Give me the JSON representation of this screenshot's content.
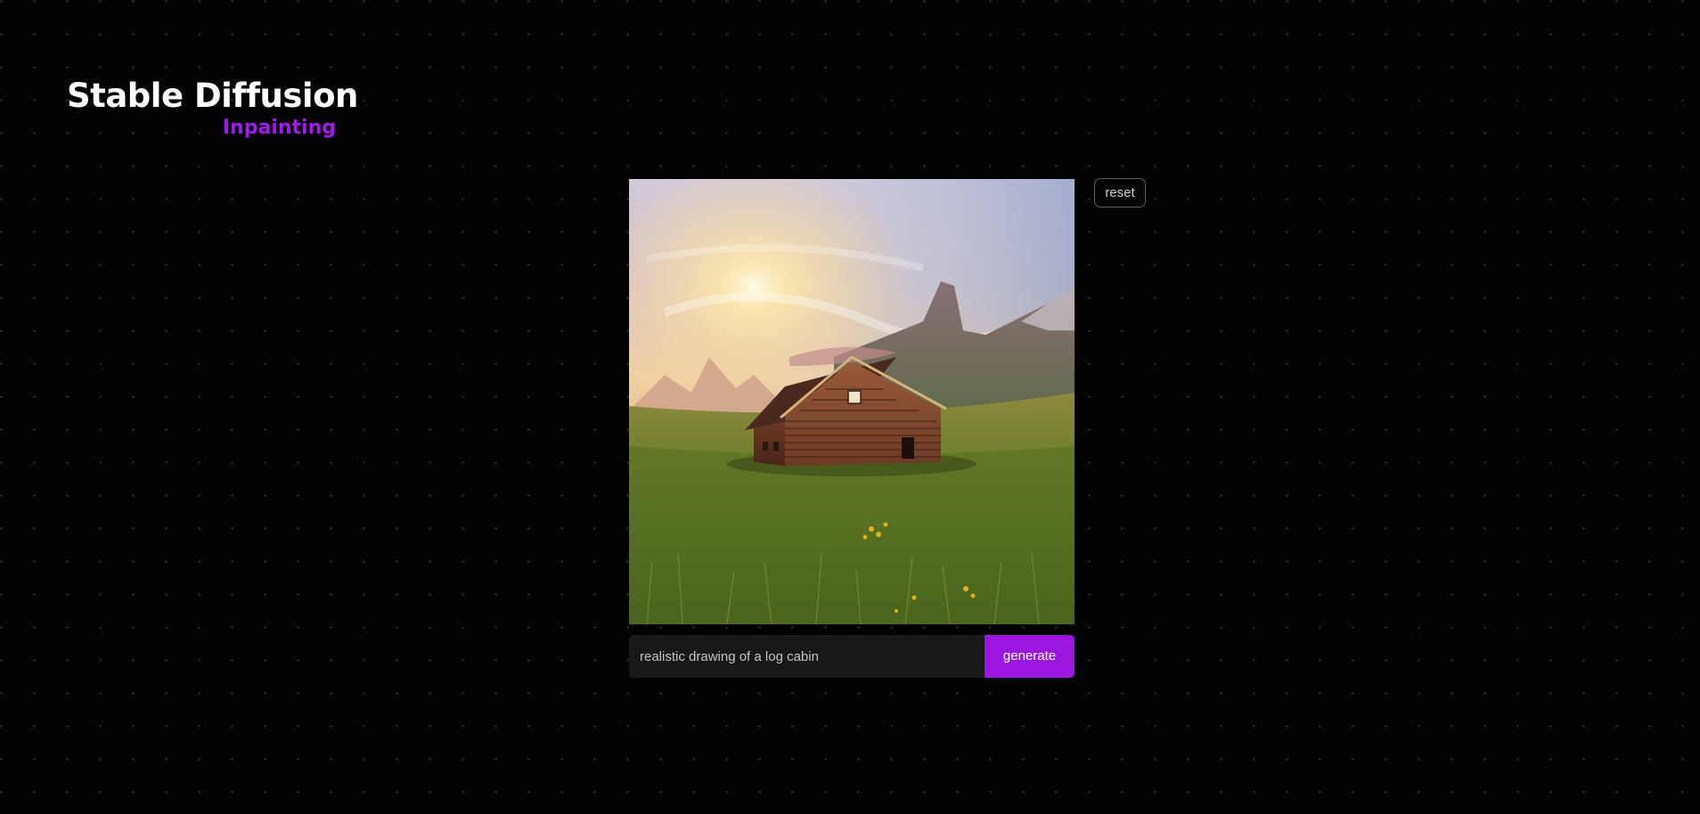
{
  "header": {
    "title": "Stable Diffusion",
    "subtitle": "Inpainting"
  },
  "controls": {
    "reset_label": "reset"
  },
  "prompt": {
    "value": "realistic drawing of a log cabin",
    "generate_label": "generate"
  },
  "colors": {
    "accent": "#9b17e0",
    "background": "#030303"
  },
  "icons": {
    "image": "log-cabin-landscape-image"
  }
}
